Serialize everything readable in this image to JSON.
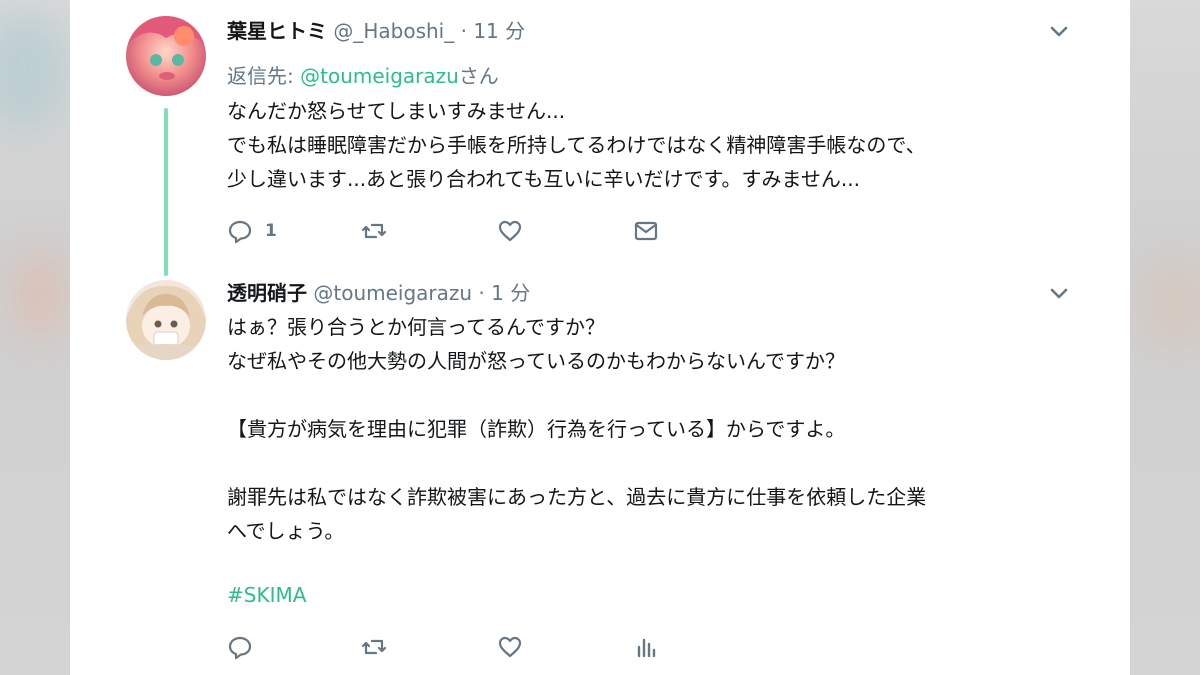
{
  "tweets": [
    {
      "display_name": "葉星ヒトミ",
      "handle": "@_Haboshi_",
      "separator": "·",
      "time": "11 分",
      "reply_label": "返信先: ",
      "reply_mention": "@toumeigarazu",
      "reply_suffix": "さん",
      "text": "なんだか怒らせてしまいすみません...\nでも私は睡眠障害だから手帳を所持してるわけではなく精神障害手帳なので、\n少し違います...あと張り合われても互いに辛いだけです。すみません...",
      "reply_count": "1",
      "icons": [
        "reply-icon",
        "retweet-icon",
        "like-icon",
        "message-icon"
      ]
    },
    {
      "display_name": "透明硝子",
      "handle": "@toumeigarazu",
      "separator": "·",
      "time": "1 分",
      "text": "はぁ？張り合うとか何言ってるんですか？\nなぜ私やその他大勢の人間が怒っているのかもわからないんですか？\n\n【貴方が病気を理由に犯罪（詐欺）行為を行っている】からですよ。\n\n謝罪先は私ではなく詐欺被害にあった方と、過去に貴方に仕事を依頼した企業\nへでしょう。",
      "hashtag": "#SKIMA",
      "icons": [
        "reply-icon",
        "retweet-icon",
        "like-icon",
        "analytics-icon"
      ]
    }
  ],
  "colors": {
    "accent_green": "#2bbf86",
    "thread_line": "#7ee0b4",
    "muted_text": "#657786",
    "primary_text": "#14171a"
  }
}
